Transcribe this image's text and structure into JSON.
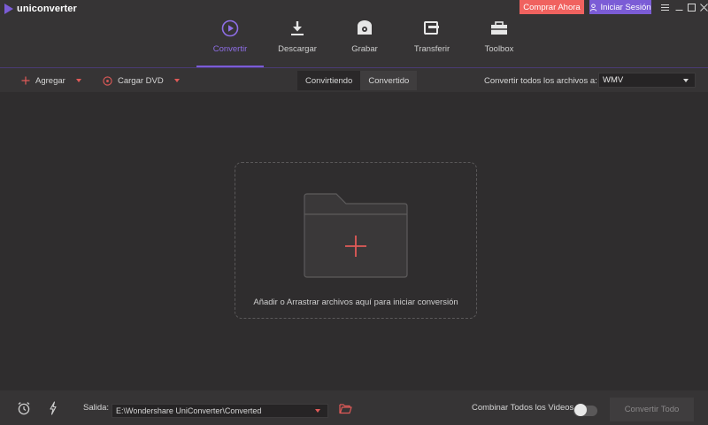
{
  "app": {
    "name": "uniconverter"
  },
  "header": {
    "buy_label": "Comprar Ahora",
    "login_label": "Iniciar Sesión"
  },
  "nav": {
    "tabs": [
      {
        "label": "Convertir",
        "icon": "convert-icon",
        "active": true
      },
      {
        "label": "Descargar",
        "icon": "download-icon"
      },
      {
        "label": "Grabar",
        "icon": "burn-icon"
      },
      {
        "label": "Transferir",
        "icon": "transfer-icon"
      },
      {
        "label": "Toolbox",
        "icon": "toolbox-icon"
      }
    ]
  },
  "toolbar": {
    "add_label": "Agregar",
    "load_dvd_label": "Cargar DVD",
    "segments": [
      "Convirtiendo",
      "Convertido"
    ],
    "convert_all_label": "Convertir todos los archivos a:",
    "format_value": "WMV"
  },
  "main": {
    "drop_text": "Añadir o Arrastrar archivos aquí para iniciar conversión"
  },
  "bottom": {
    "output_label": "Salida:",
    "output_path": "E:\\Wondershare UniConverter\\Converted",
    "combine_label": "Combinar Todos los Videos",
    "combine_on": false,
    "convert_all_button": "Convertir Todo"
  },
  "colors": {
    "accent_purple": "#7b5cd6",
    "accent_red": "#f0625f",
    "background": "#2f2d2e"
  }
}
